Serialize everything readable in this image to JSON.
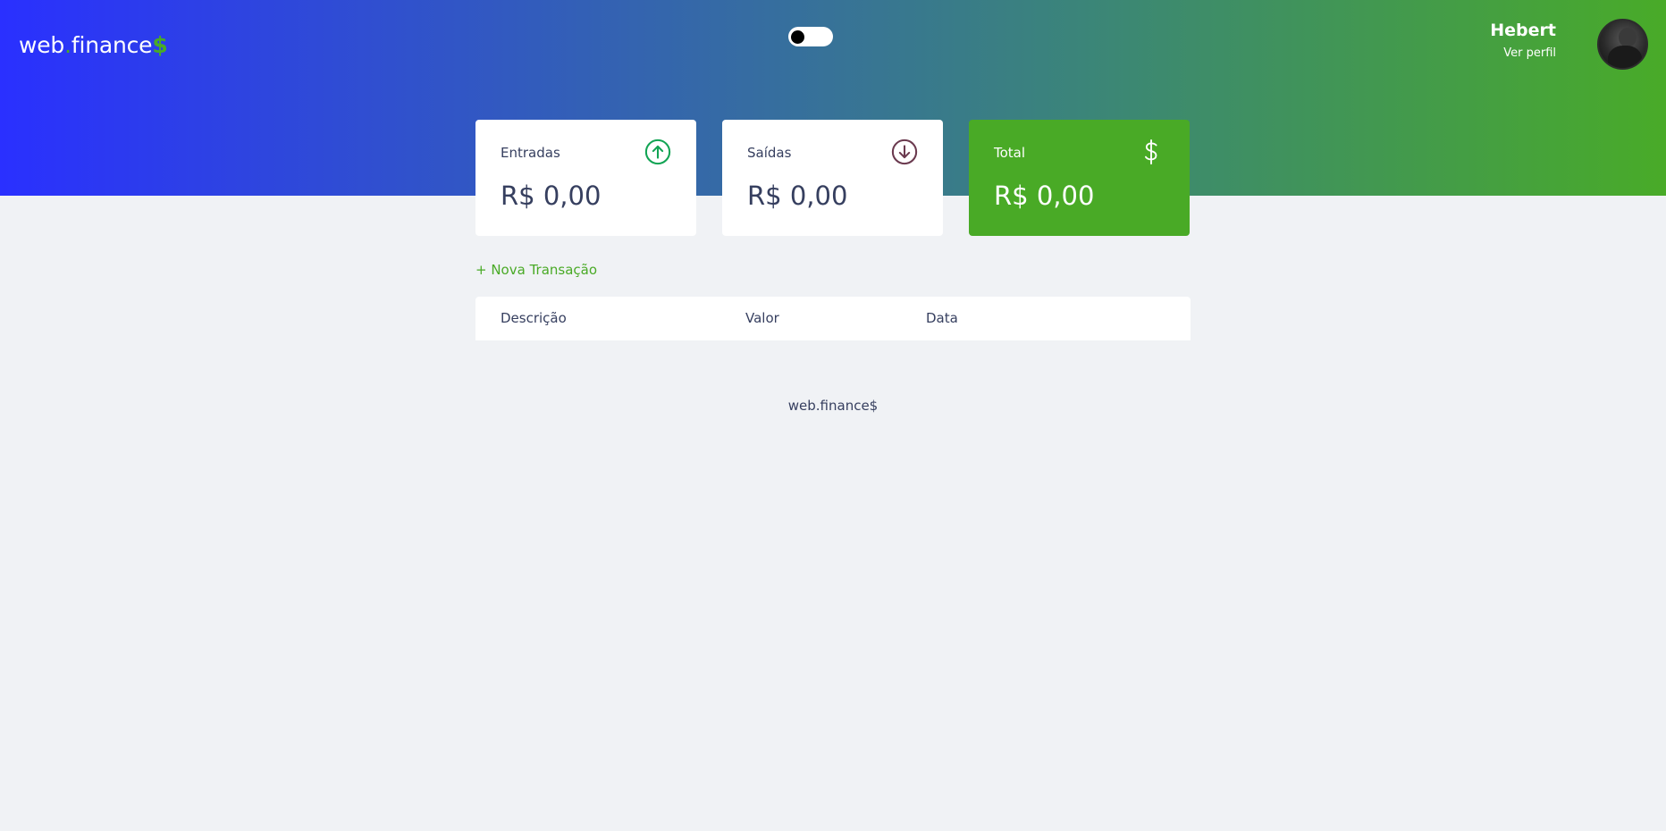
{
  "header": {
    "logo": {
      "text": "web",
      "dot": ".",
      "text2": "finance",
      "dollar": "$"
    },
    "theme_toggle": {
      "state": "off"
    },
    "profile": {
      "name": "Hebert",
      "link": "Ver perfil"
    }
  },
  "cards": [
    {
      "label": "Entradas",
      "amount": "R$ 0,00",
      "icon": "arrow-up-circle-icon",
      "icon_color": "#12a454"
    },
    {
      "label": "Saídas",
      "amount": "R$ 0,00",
      "icon": "arrow-down-circle-icon",
      "icon_color": "#e92929"
    },
    {
      "label": "Total",
      "amount": "R$ 0,00",
      "icon": "dollar-sign-icon",
      "icon_color": "#ffffff"
    }
  ],
  "transactions": {
    "new_label": "+ Nova Transação",
    "columns": [
      "Descrição",
      "Valor",
      "Data"
    ],
    "rows": []
  },
  "footer": {
    "text": "web.finance$"
  },
  "colors": {
    "accent": "#49aa26",
    "text": "#363f5f",
    "background": "#f0f2f5",
    "header_gradient_start": "#2a30ff",
    "header_gradient_end": "#49ab28"
  }
}
